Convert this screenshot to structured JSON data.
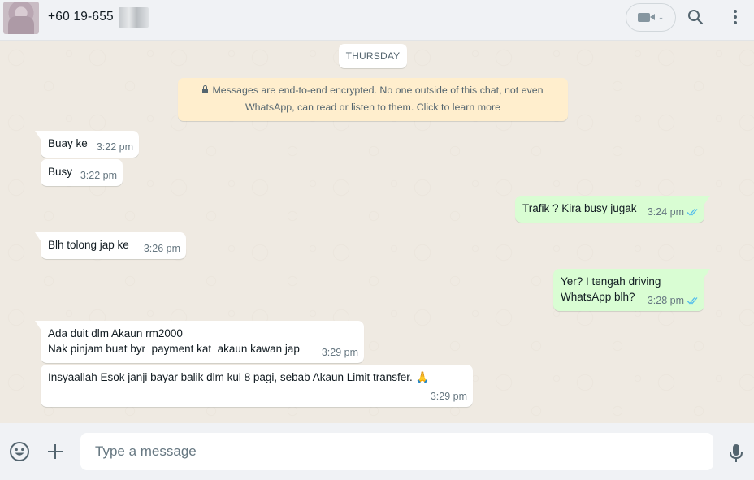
{
  "header": {
    "contact_name": "+60 19-655",
    "video_call_icon": "video-camera-icon",
    "video_menu_icon": "chevron-down-icon",
    "search_icon": "search-icon",
    "menu_icon": "kebab-menu-icon"
  },
  "chat": {
    "day_label": "THURSDAY",
    "encryption_note": "Messages are end-to-end encrypted. No one outside of this chat, not even WhatsApp, can read or listen to them. Click to learn more",
    "messages": [
      {
        "direction": "in",
        "text": "Buay ke",
        "time": "3:22 pm"
      },
      {
        "direction": "in",
        "text": "Busy",
        "time": "3:22 pm"
      },
      {
        "direction": "out",
        "text": "Trafik ? Kira busy jugak",
        "time": "3:24 pm",
        "status": "read"
      },
      {
        "direction": "in",
        "text": "Blh tolong jap ke",
        "time": "3:26 pm"
      },
      {
        "direction": "out",
        "text": "Yer? I tengah driving\nWhatsApp blh?",
        "time": "3:28 pm",
        "status": "read"
      },
      {
        "direction": "in",
        "text": "Ada duit dlm Akaun rm2000\nNak pinjam buat byr  payment kat  akaun kawan jap",
        "time": "3:29 pm"
      },
      {
        "direction": "in",
        "text": "Insyaallah Esok janji bayar balik dlm kul 8 pagi, sebab Akaun Limit transfer. 🙏",
        "time": "3:29 pm"
      }
    ]
  },
  "footer": {
    "emoji_icon": "emoji-icon",
    "attach_icon": "plus-icon",
    "message_placeholder": "Type a message",
    "mic_icon": "microphone-icon"
  },
  "colors": {
    "incoming_bubble": "#ffffff",
    "outgoing_bubble": "#d9fdd3",
    "chat_background": "#efeae2",
    "read_ticks": "#53bdeb"
  }
}
